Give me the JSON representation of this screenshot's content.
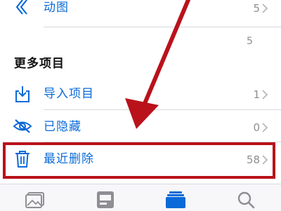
{
  "rows": {
    "animated": {
      "label": "动图",
      "count": "5"
    },
    "faint_count": "5",
    "import": {
      "label": "导入项目",
      "count": "1"
    },
    "hidden": {
      "label": "已隐藏",
      "count": "0"
    },
    "recently_deleted": {
      "label": "最近删除",
      "count": "58"
    }
  },
  "section": {
    "title": "更多项目"
  },
  "icons": {
    "animated": "animated-icon",
    "import": "import-icon",
    "hidden": "hidden-eye-icon",
    "recently_deleted": "trash-icon",
    "tab_photos": "photos-tab-icon",
    "tab_for_you": "for-you-tab-icon",
    "tab_albums": "albums-tab-icon",
    "tab_search": "search-tab-icon"
  },
  "colors": {
    "accent": "#0a6ad8",
    "annotation_red": "#b9121b",
    "secondary_text": "#8e8e93"
  },
  "active_tab": "albums"
}
